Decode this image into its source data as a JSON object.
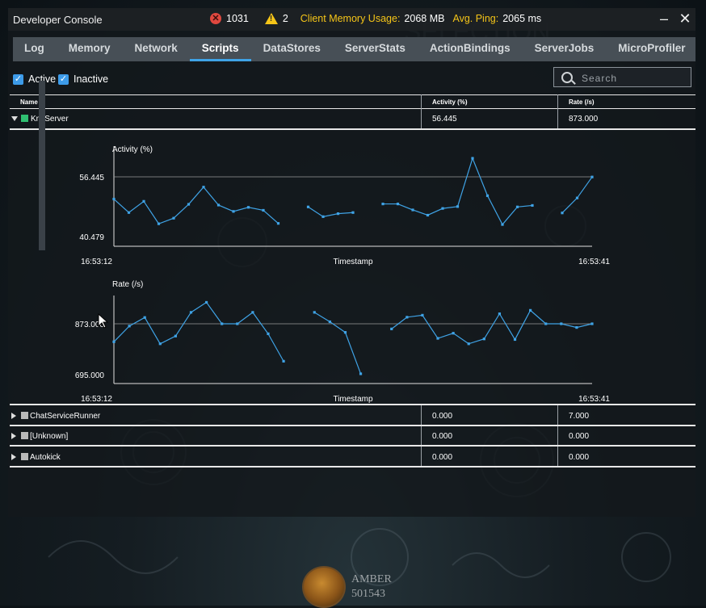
{
  "window": {
    "title": "Developer Console",
    "error_count": "1031",
    "warning_count": "2",
    "memory_label": "Client Memory Usage:",
    "memory_value": "2068 MB",
    "ping_label": "Avg. Ping:",
    "ping_value": "2065 ms"
  },
  "tabs": [
    "Log",
    "Memory",
    "Network",
    "Scripts",
    "DataStores",
    "ServerStats",
    "ActionBindings",
    "ServerJobs",
    "MicroProfiler"
  ],
  "active_tab": "Scripts",
  "filters": {
    "active": "Active",
    "inactive": "Inactive"
  },
  "search": {
    "placeholder": "Search"
  },
  "table": {
    "headers": {
      "name": "Name",
      "activity": "Activity (%)",
      "rate": "Rate (/s)"
    },
    "rows": [
      {
        "name": "KnitServer",
        "activity": "56.445",
        "rate": "873.000",
        "color": "#2fbf71",
        "expanded": true
      },
      {
        "name": "ChatServiceRunner",
        "activity": "0.000",
        "rate": "7.000",
        "color": "#b9b9b9",
        "expanded": false
      },
      {
        "name": "[Unknown]",
        "activity": "0.000",
        "rate": "0.000",
        "color": "#b9b9b9",
        "expanded": false
      },
      {
        "name": "Autokick",
        "activity": "0.000",
        "rate": "0.000",
        "color": "#b9b9b9",
        "expanded": false
      }
    ]
  },
  "charts": [
    {
      "ylabel": "Activity (%)",
      "ref_label": "56.445",
      "min_label": "40.479",
      "x_start": "16:53:12",
      "x_end": "16:53:41",
      "xlabel": "Timestamp"
    },
    {
      "ylabel": "Rate (/s)",
      "ref_label": "873.000",
      "min_label": "695.000",
      "x_start": "16:53:12",
      "x_end": "16:53:41",
      "xlabel": "Timestamp"
    }
  ],
  "chart_data": [
    {
      "type": "line",
      "ylabel": "Activity (%)",
      "xlabel": "Timestamp",
      "x_range": [
        "16:53:12",
        "16:53:41"
      ],
      "ref_value": 56.445,
      "ylim": [
        40.479,
        56.445
      ],
      "series": [
        {
          "values": [
            50.5,
            46.9,
            49.9,
            43.9,
            45.4,
            49.1,
            53.7,
            48.9,
            47.2,
            48.3,
            47.5,
            44.0
          ]
        },
        {
          "values": [
            48.4,
            45.8,
            46.6,
            46.9
          ]
        },
        {
          "values": [
            49.2,
            49.2,
            47.6,
            46.2,
            48.0,
            48.5,
            61.4,
            51.4,
            43.7,
            48.4,
            48.8
          ]
        },
        {
          "values": [
            46.8,
            50.8,
            56.4
          ]
        }
      ]
    },
    {
      "type": "line",
      "ylabel": "Rate (/s)",
      "xlabel": "Timestamp",
      "x_range": [
        "16:53:12",
        "16:53:41"
      ],
      "ref_value": 873.0,
      "ylim": [
        695.0,
        873.0
      ],
      "series": [
        {
          "values": [
            810,
            865,
            895,
            803,
            830,
            913,
            948,
            873,
            873,
            913,
            838,
            742
          ]
        },
        {
          "values": [
            913,
            880,
            843,
            698
          ]
        },
        {
          "values": [
            855,
            896,
            903,
            822,
            840,
            803,
            820,
            908,
            818,
            920,
            873,
            873,
            860,
            873
          ]
        }
      ]
    }
  ],
  "background": {
    "caption": "AMBER",
    "caption_value": "501543"
  }
}
